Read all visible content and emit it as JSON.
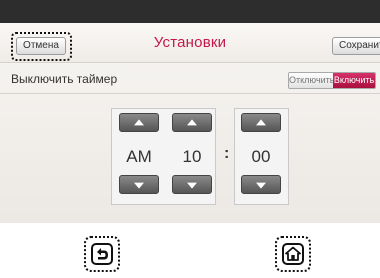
{
  "header": {
    "cancel_label": "Отмена",
    "title": "Установки",
    "save_label": "Сохранить"
  },
  "timer": {
    "label": "Выключить таймер",
    "off_label": "Отключить",
    "on_label": "Включить",
    "state": "on"
  },
  "time_picker": {
    "period": "AM",
    "hour": "10",
    "separator": ":",
    "minute": "00"
  },
  "navigation": {
    "back_icon": "back-arrow-icon",
    "home_icon": "home-icon"
  },
  "colors": {
    "accent": "#c2184a",
    "status_bar": "#2d2d2d",
    "button_dark": "#555555"
  }
}
